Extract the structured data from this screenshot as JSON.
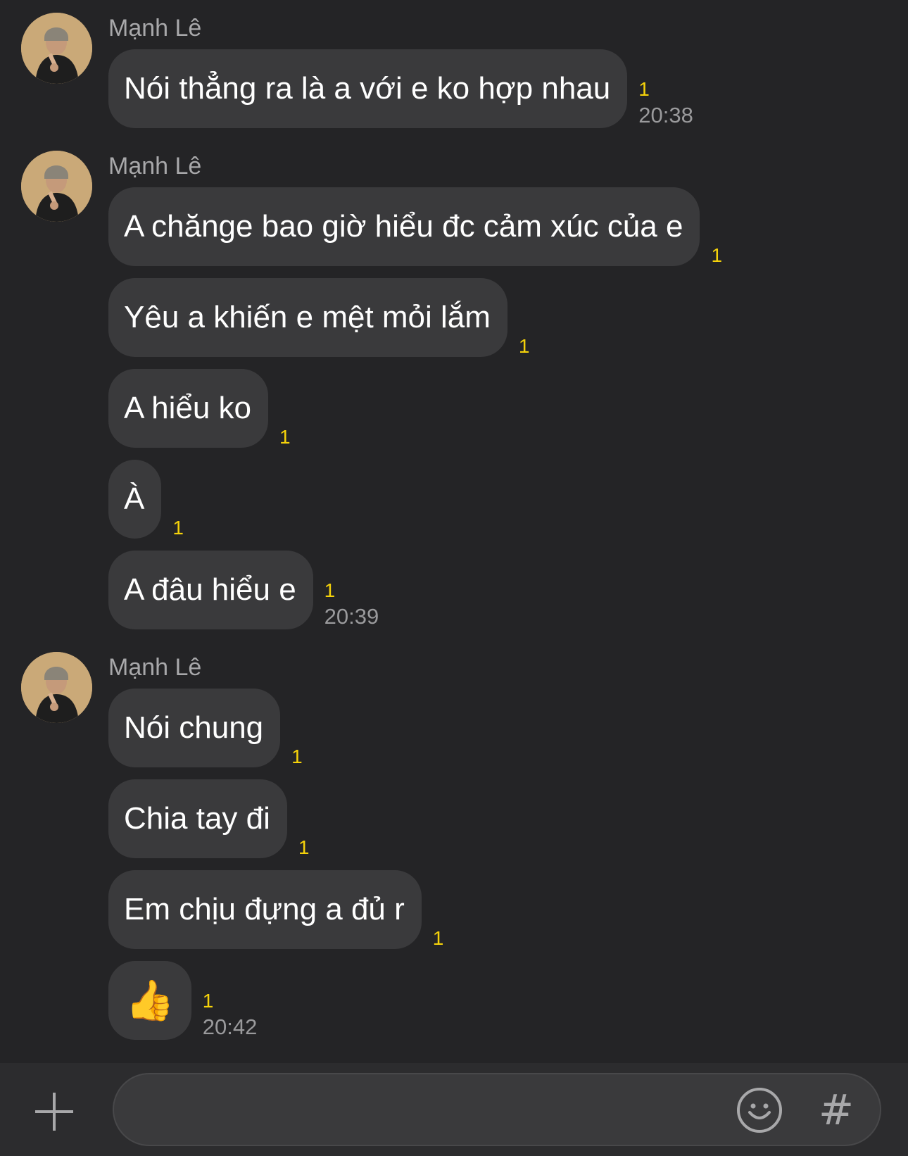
{
  "messages": {
    "groups": [
      {
        "sender": "Mạnh Lê",
        "items": [
          {
            "text": "Nói thẳng ra là a với e ko hợp nhau",
            "unread": "1",
            "time": "20:38"
          }
        ]
      },
      {
        "sender": "Mạnh Lê",
        "items": [
          {
            "text": "A chăngе bao giờ hiểu đc cảm xúc của e",
            "unread": "1",
            "time": ""
          },
          {
            "text": "Yêu a khiến e mệt mỏi lắm",
            "unread": "1",
            "time": ""
          },
          {
            "text": "A hiểu ko",
            "unread": "1",
            "time": ""
          },
          {
            "text": "À",
            "unread": "1",
            "time": ""
          },
          {
            "text": "A đâu hiểu e",
            "unread": "1",
            "time": "20:39"
          }
        ]
      },
      {
        "sender": "Mạnh Lê",
        "items": [
          {
            "text": "Nói chung",
            "unread": "1",
            "time": ""
          },
          {
            "text": "Chia tay đi",
            "unread": "1",
            "time": ""
          },
          {
            "text": "Em chịu đựng a đủ r",
            "unread": "1",
            "time": ""
          },
          {
            "text": "👍",
            "unread": "1",
            "time": "20:42"
          }
        ]
      }
    ]
  },
  "input_bar": {
    "plus_icon": "plus-icon",
    "emoji_icon": "smiley-icon",
    "hash_label": "#",
    "placeholder": ""
  },
  "colors": {
    "background": "#242426",
    "bubble": "#3a3a3c",
    "unread": "#f5d20a",
    "secondary_text": "#a8a8aa"
  }
}
